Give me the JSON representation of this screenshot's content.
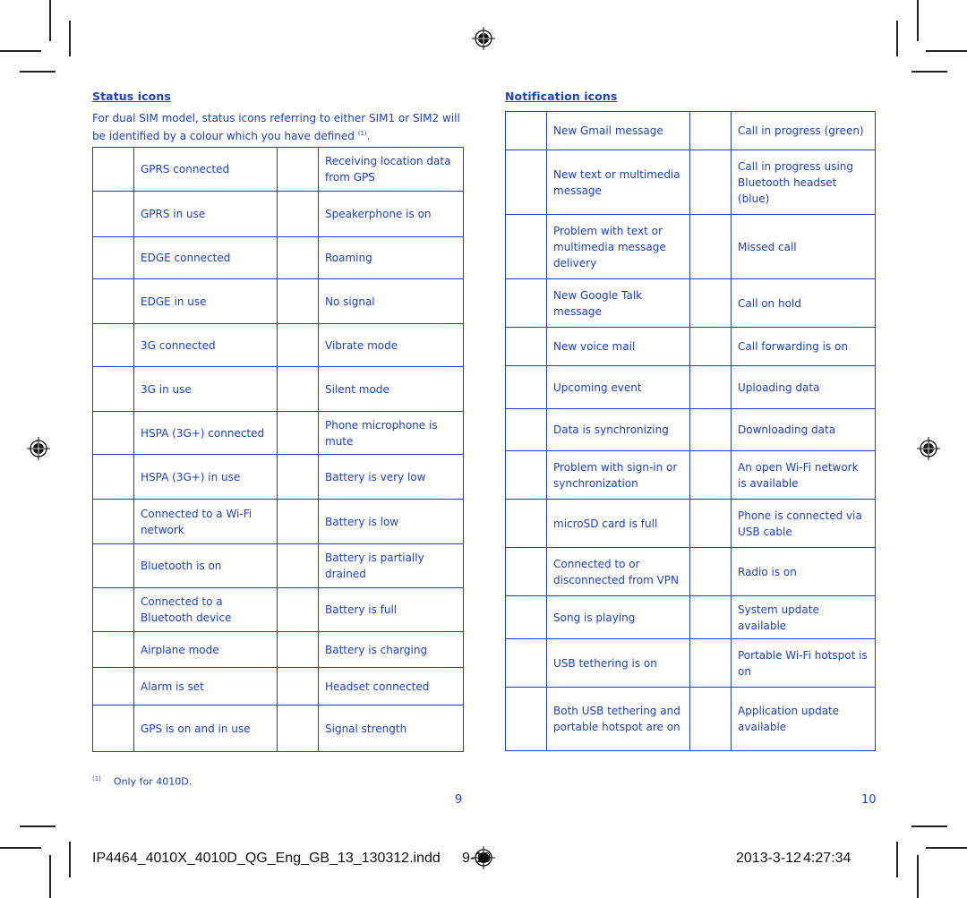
{
  "left_page": {
    "heading": "Status icons",
    "intro": "For dual SIM model, status icons referring to either SIM1 or SIM2 will be identified by a colour which you have defined",
    "intro_footnote_ref": "(1)",
    "intro_end": ".",
    "rows": [
      {
        "left": "GPRS connected",
        "right": "Receiving location data from GPS"
      },
      {
        "left": "GPRS in use",
        "right": "Speakerphone is on"
      },
      {
        "left": "EDGE connected",
        "right": "Roaming"
      },
      {
        "left": "EDGE in use",
        "right": "No signal"
      },
      {
        "left": "3G connected",
        "right": "Vibrate mode"
      },
      {
        "left": "3G in use",
        "right": "Silent mode"
      },
      {
        "left": "HSPA (3G+) connected",
        "right": "Phone microphone is mute"
      },
      {
        "left": "HSPA (3G+) in use",
        "right": "Battery is very low"
      },
      {
        "left": "Connected to a Wi-Fi network",
        "right": "Battery is low"
      },
      {
        "left": "Bluetooth is on",
        "right": "Battery is partially drained"
      },
      {
        "left": "Connected to a Bluetooth device",
        "right": "Battery is full"
      },
      {
        "left": "Airplane mode",
        "right": "Battery is charging"
      },
      {
        "left": "Alarm is set",
        "right": "Headset connected"
      },
      {
        "left": "GPS is on and in use",
        "right": "Signal strength"
      }
    ],
    "footnote_marker": "(1)",
    "footnote_text": "Only for 4010D.",
    "page_number": "9"
  },
  "right_page": {
    "heading": "Notification icons",
    "rows": [
      {
        "left": "New Gmail message",
        "right": "Call in progress (green)"
      },
      {
        "left": "New text or multimedia message",
        "right": "Call in progress using Bluetooth headset (blue)"
      },
      {
        "left": "Problem with text or multimedia message delivery",
        "right": "Missed call"
      },
      {
        "left": "New Google Talk message",
        "right": "Call on hold"
      },
      {
        "left": "New voice mail",
        "right": "Call forwarding is on"
      },
      {
        "left": "Upcoming event",
        "right": "Uploading data"
      },
      {
        "left": "Data is synchronizing",
        "right": "Downloading data"
      },
      {
        "left": "Problem with sign-in or synchronization",
        "right": "An open Wi-Fi network is available"
      },
      {
        "left": "microSD card is full",
        "right": "Phone is connected via USB cable"
      },
      {
        "left": "Connected to or disconnected from VPN",
        "right": "Radio is on"
      },
      {
        "left": "Song is playing",
        "right": "System update available"
      },
      {
        "left": "USB tethering is on",
        "right": "Portable Wi-Fi hotspot is on"
      },
      {
        "left": "Both USB tethering and portable hotspot are on",
        "right": "Application update available"
      }
    ],
    "page_number": "10"
  },
  "slug": {
    "filename": "IP4464_4010X_4010D_QG_Eng_GB_13_130312.indd",
    "pages": "9-10",
    "date": "2013-3-12",
    "time": "4:27:34"
  },
  "colors": {
    "text_blue": "#1a3fd6",
    "slug_black": "#111111"
  }
}
